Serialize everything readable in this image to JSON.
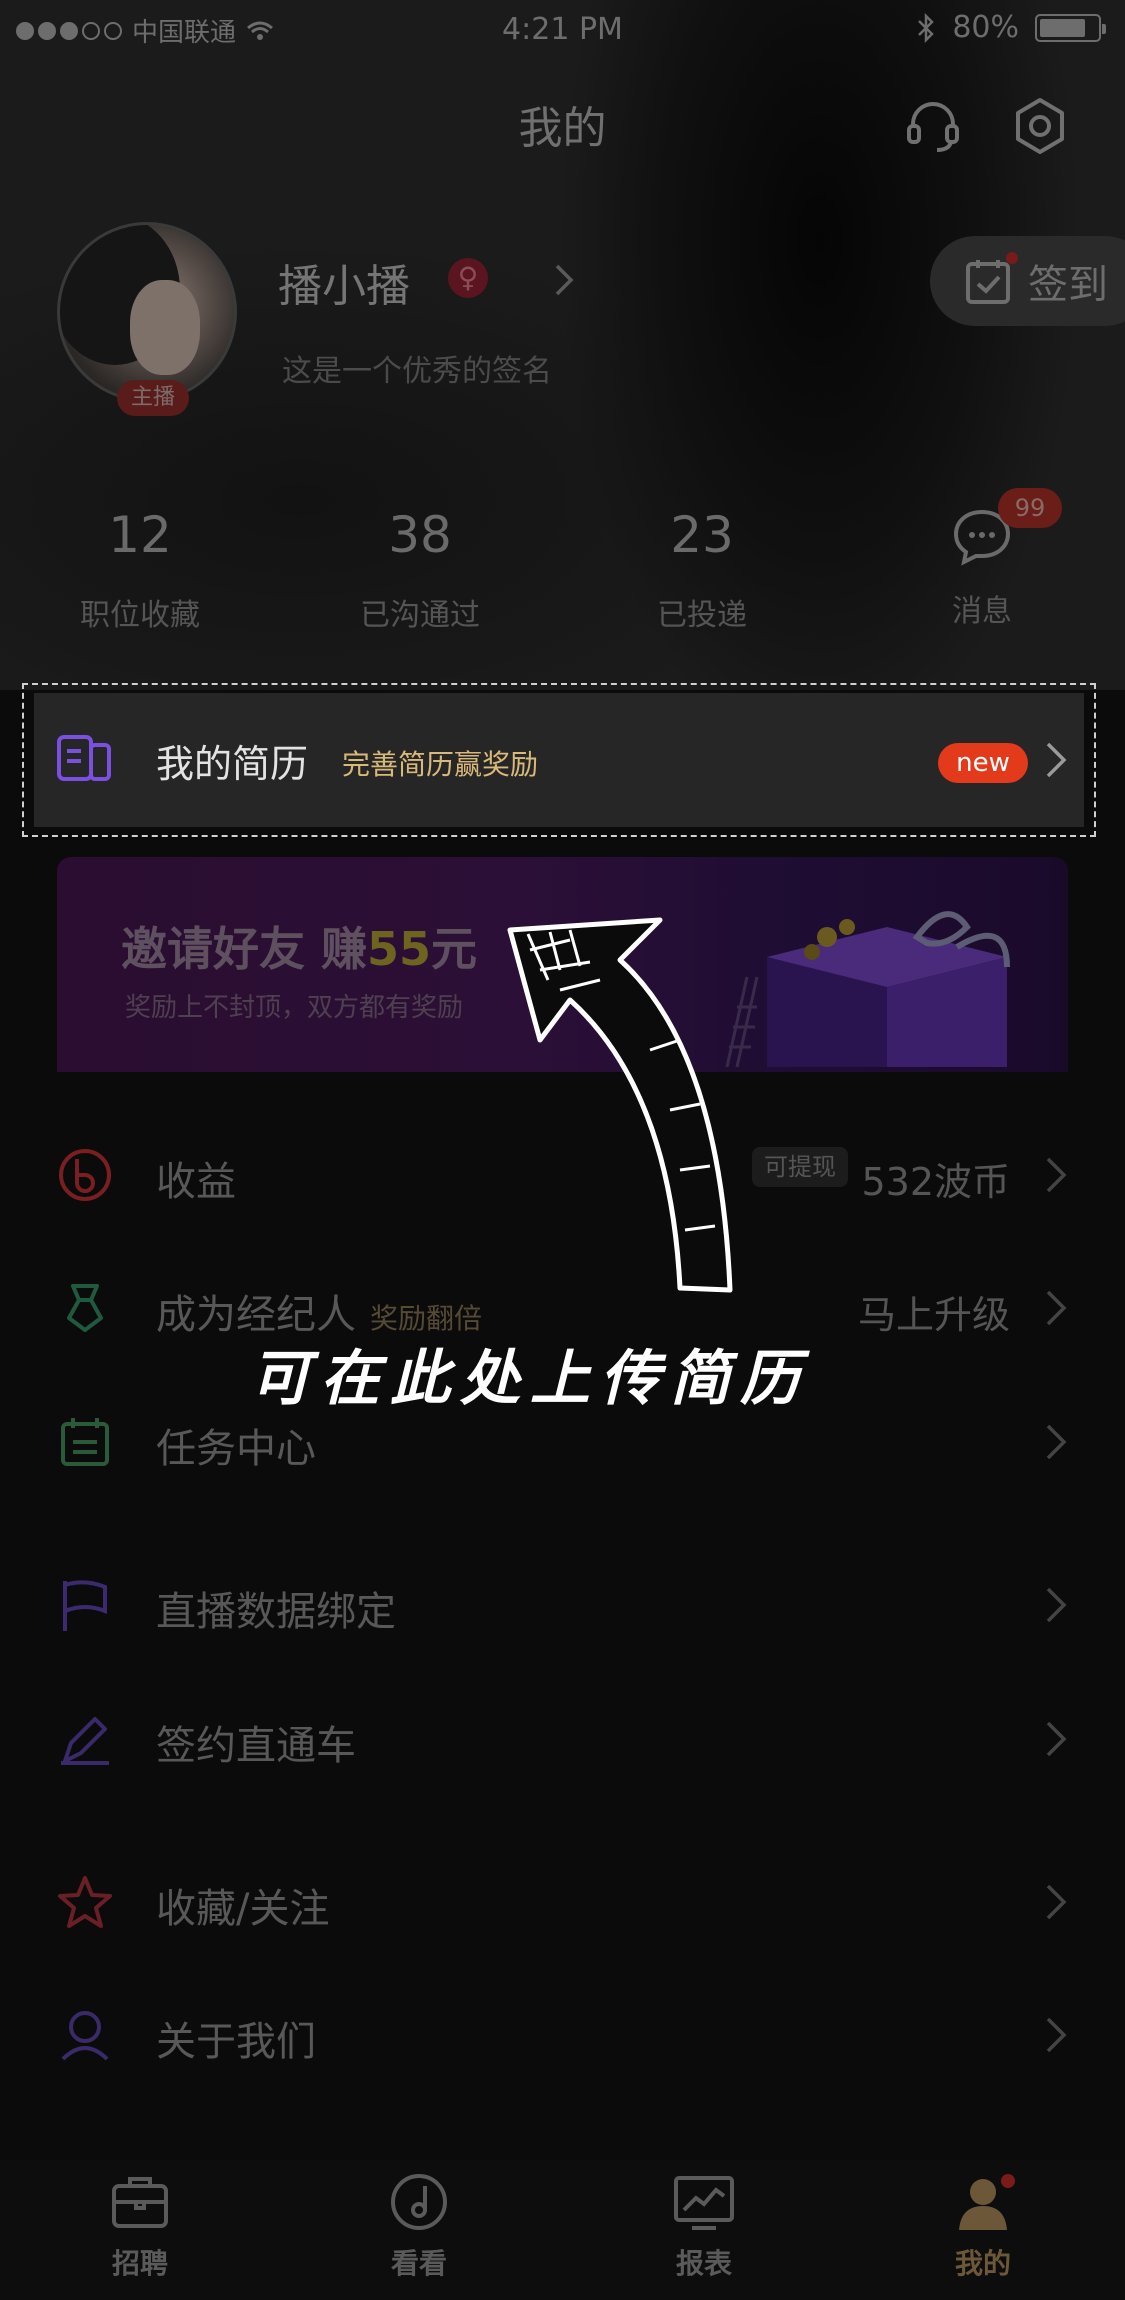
{
  "status_bar": {
    "carrier": "中国联通",
    "time": "4:21 PM",
    "battery": "80%"
  },
  "header": {
    "title": "我的",
    "support_icon": "headset-icon",
    "settings_icon": "gear-icon"
  },
  "profile": {
    "name": "播小播",
    "gender_symbol": "♀",
    "signature": "这是一个优秀的签名",
    "role_badge": "主播",
    "checkin_label": "签到"
  },
  "stats": [
    {
      "value": "12",
      "label": "职位收藏"
    },
    {
      "value": "38",
      "label": "已沟通过"
    },
    {
      "value": "23",
      "label": "已投递"
    }
  ],
  "messages": {
    "label": "消息",
    "badge": "99"
  },
  "resume": {
    "title": "我的简历",
    "subtitle": "完善简历赢奖励",
    "badge": "new"
  },
  "banner": {
    "headline_prefix": "邀请好友 赚",
    "amount": "55",
    "unit": "元",
    "subline": "奖励上不封顶，双方都有奖励"
  },
  "menu": [
    {
      "label": "收益",
      "tag": "",
      "badge": "可提现",
      "value": "532波币",
      "icon": "coin-b-icon",
      "color": "#7a1f1f"
    },
    {
      "label": "成为经纪人",
      "tag": "奖励翻倍",
      "badge": "",
      "value": "马上升级",
      "icon": "agent-icon",
      "color": "#1e5a3e"
    },
    {
      "label": "任务中心",
      "tag": "",
      "badge": "",
      "value": "",
      "icon": "calendar-icon",
      "color": "#2a5a3a"
    },
    {
      "label": "直播数据绑定",
      "tag": "",
      "badge": "",
      "value": "",
      "icon": "flag-icon",
      "color": "#3c2a70"
    },
    {
      "label": "签约直通车",
      "tag": "",
      "badge": "",
      "value": "",
      "icon": "pen-icon",
      "color": "#3a2a6a"
    },
    {
      "label": "收藏/关注",
      "tag": "",
      "badge": "",
      "value": "",
      "icon": "star-icon",
      "color": "#6a1f26"
    },
    {
      "label": "关于我们",
      "tag": "",
      "badge": "",
      "value": "",
      "icon": "user-icon",
      "color": "#3a2a6a"
    }
  ],
  "hint_text": "可在此处上传简历",
  "tabs": [
    {
      "label": "招聘",
      "icon": "briefcase-icon",
      "active": false
    },
    {
      "label": "看看",
      "icon": "disc-icon",
      "active": false
    },
    {
      "label": "报表",
      "icon": "chart-icon",
      "active": false
    },
    {
      "label": "我的",
      "icon": "profile-icon",
      "active": true
    }
  ]
}
